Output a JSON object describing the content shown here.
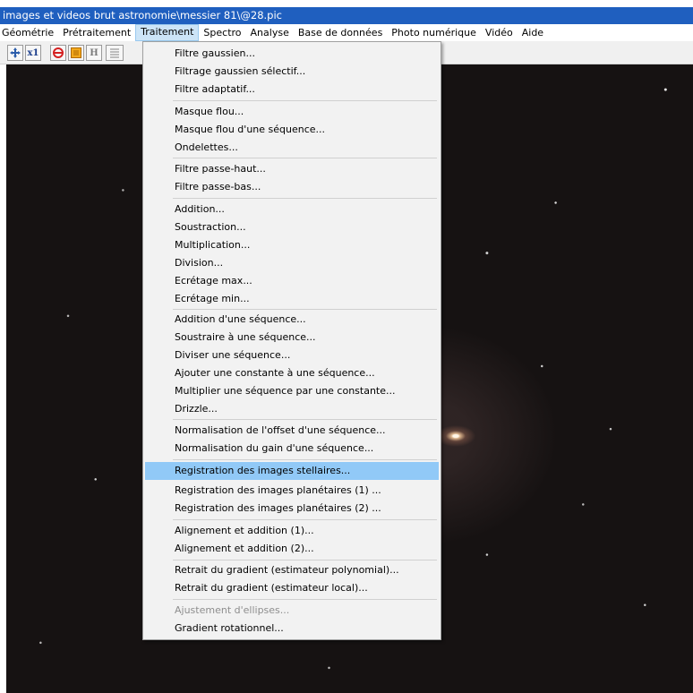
{
  "window": {
    "title": "images et videos brut astronomie\\messier 81\\@28.pic"
  },
  "menubar": {
    "items": [
      "Géométrie",
      "Prétraitement",
      "Traitement",
      "Spectro",
      "Analyse",
      "Base de données",
      "Photo numérique",
      "Vidéo",
      "Aide"
    ],
    "active": "Traitement"
  },
  "toolbar": {
    "zoom_label": "x1",
    "h_label": "H"
  },
  "menu": {
    "items": [
      {
        "label": "Filtre gaussien..."
      },
      {
        "label": "Filtrage gaussien sélectif..."
      },
      {
        "label": "Filtre adaptatif..."
      },
      {
        "label": "Masque flou..."
      },
      {
        "label": "Masque flou d'une séquence..."
      },
      {
        "label": "Ondelettes..."
      },
      {
        "label": "Filtre passe-haut..."
      },
      {
        "label": "Filtre passe-bas..."
      },
      {
        "label": "Addition..."
      },
      {
        "label": "Soustraction..."
      },
      {
        "label": "Multiplication..."
      },
      {
        "label": "Division..."
      },
      {
        "label": "Ecrétage max..."
      },
      {
        "label": "Ecrétage min..."
      },
      {
        "label": "Addition d'une séquence..."
      },
      {
        "label": "Soustraire à une séquence..."
      },
      {
        "label": "Diviser une séquence..."
      },
      {
        "label": "Ajouter une constante à une séquence..."
      },
      {
        "label": "Multiplier une séquence par une constante..."
      },
      {
        "label": "Drizzle..."
      },
      {
        "label": "Normalisation de l'offset d'une séquence..."
      },
      {
        "label": "Normalisation du gain d'une séquence..."
      },
      {
        "label": "Registration des images stellaires...",
        "highlighted": true
      },
      {
        "label": "Registration des images planétaires (1) ..."
      },
      {
        "label": "Registration des images planétaires (2) ..."
      },
      {
        "label": "Alignement et addition (1)..."
      },
      {
        "label": "Alignement et addition (2)..."
      },
      {
        "label": "Retrait du gradient (estimateur polynomial)..."
      },
      {
        "label": "Retrait du gradient (estimateur local)..."
      },
      {
        "label": "Ajustement d'ellipses...",
        "disabled": true
      },
      {
        "label": "Gradient rotationnel..."
      }
    ]
  },
  "colors": {
    "titlebar": "#1f5fbf",
    "highlight": "#91c9f7",
    "menu_background": "#f2f2f2",
    "image_background": "#161212"
  },
  "icons": [
    "move-icon",
    "zoom-x1-icon",
    "red-circle-icon",
    "orange-square-icon",
    "h-icon",
    "list-icon"
  ]
}
